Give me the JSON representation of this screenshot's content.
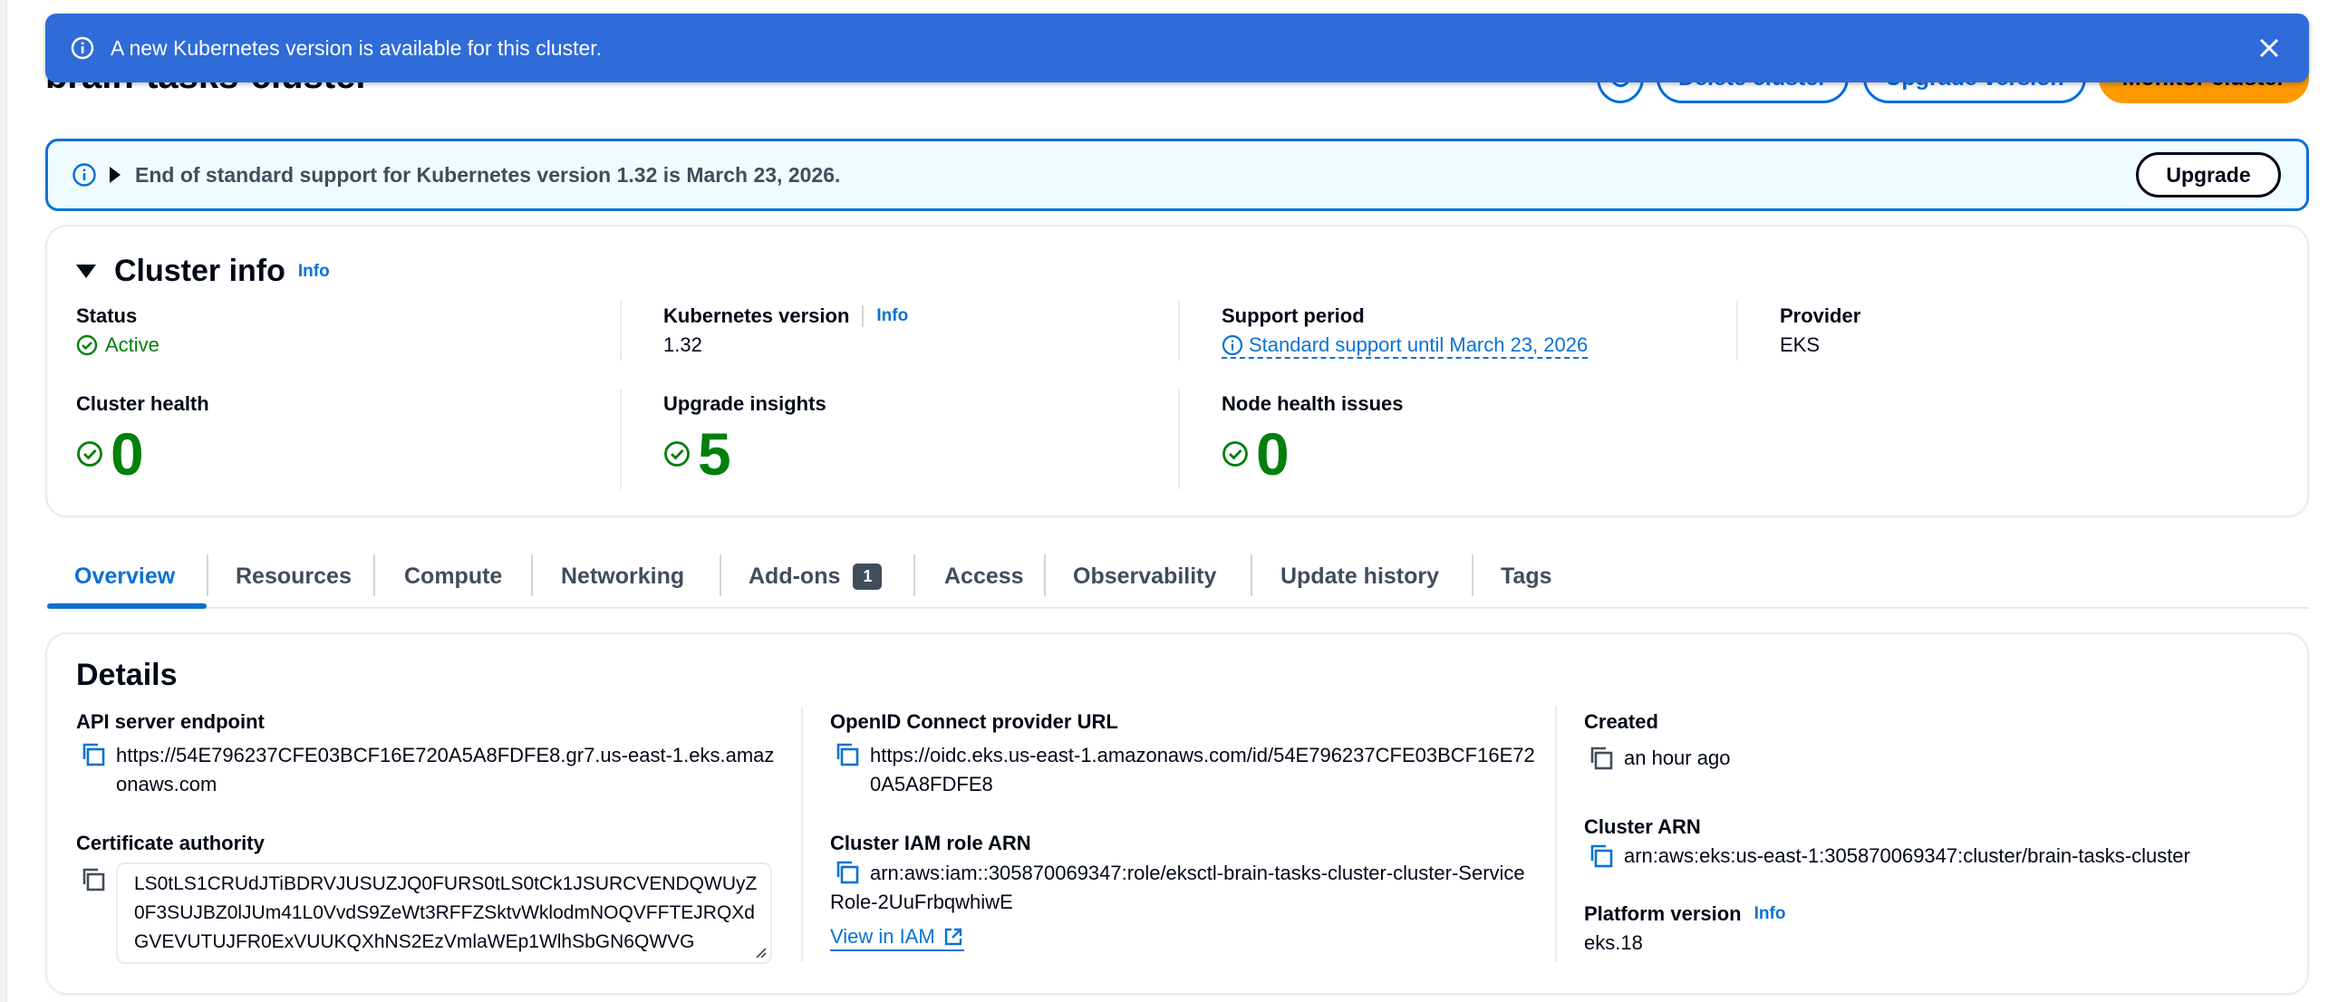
{
  "header": {
    "title": "brain-tasks-cluster",
    "delete_label": "Delete cluster",
    "upgrade_label": "Upgrade version",
    "monitor_label": "Monitor cluster"
  },
  "flash": {
    "message": "A new Kubernetes version is available for this cluster.",
    "color": "#2f6bd9"
  },
  "alert": {
    "message": "End of standard support for Kubernetes version 1.32 is March 23, 2026.",
    "button": "Upgrade"
  },
  "cluster_info": {
    "title": "Cluster info",
    "info": "Info",
    "status_label": "Status",
    "status_value": "Active",
    "k8s_label": "Kubernetes version",
    "k8s_info": "Info",
    "k8s_value": "1.32",
    "support_label": "Support period",
    "support_value": "Standard support until March 23, 2026",
    "provider_label": "Provider",
    "provider_value": "EKS",
    "health_label": "Cluster health",
    "health_value": "0",
    "insights_label": "Upgrade insights",
    "insights_value": "5",
    "node_label": "Node health issues",
    "node_value": "0"
  },
  "tabs": [
    {
      "label": "Overview"
    },
    {
      "label": "Resources"
    },
    {
      "label": "Compute"
    },
    {
      "label": "Networking"
    },
    {
      "label": "Add-ons",
      "badge": "1"
    },
    {
      "label": "Access"
    },
    {
      "label": "Observability"
    },
    {
      "label": "Update history"
    },
    {
      "label": "Tags"
    }
  ],
  "details": {
    "title": "Details",
    "api_label": "API server endpoint",
    "api_value": "https://54E796237CFE03BCF16E720A5A8FDFE8.gr7.us-east-1.eks.amazonaws.com",
    "cert_label": "Certificate authority",
    "cert_value": "LS0tLS1CRUdJTiBDRVJUSUZJQ0FURS0tLS0tCk1JSURCVENDQWUyZ0F3SUJBZ0lJUm41L0VvdS9ZeWt3RFFZSktvWklodmNOQVFFTEJRQXdGVEVUTUJFR0ExVUUKQXhNS2EzVmlaWEp1WlhSbGN6QWVG",
    "oidc_label": "OpenID Connect provider URL",
    "oidc_value": "https://oidc.eks.us-east-1.amazonaws.com/id/54E796237CFE03BCF16E720A5A8FDFE8",
    "iam_label": "Cluster IAM role ARN",
    "iam_value": "arn:aws:iam::305870069347:role/eksctl-brain-tasks-cluster-cluster-ServiceRole-2UuFrbqwhiwE",
    "iam_link": "View in IAM",
    "created_label": "Created",
    "created_value": "an hour ago",
    "arn_label": "Cluster ARN",
    "arn_value": "arn:aws:eks:us-east-1:305870069347:cluster/brain-tasks-cluster",
    "platform_label": "Platform version",
    "platform_info": "Info",
    "platform_value": "eks.18"
  }
}
